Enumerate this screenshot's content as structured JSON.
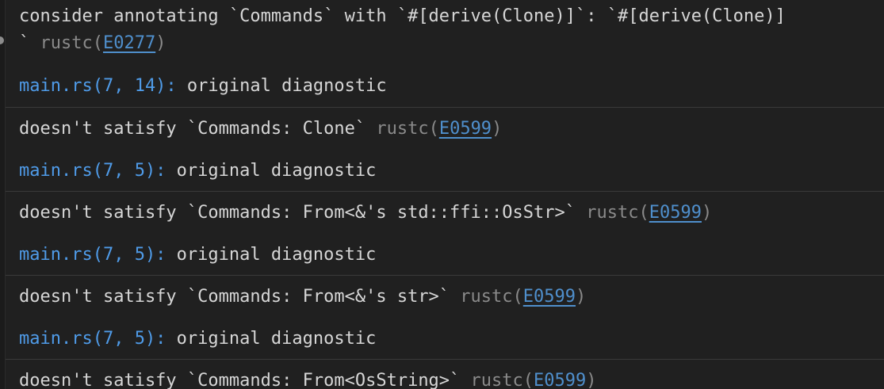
{
  "problems": {
    "entries": [
      {
        "message_lines": [
          "consider annotating `Commands` with `#[derive(Clone)]`: `#[derive(Clone)]",
          "` "
        ],
        "source": "rustc",
        "code": "E0277",
        "related_location": "main.rs(7, 14):",
        "related_text": " original diagnostic"
      },
      {
        "message": "doesn't satisfy `Commands: Clone` ",
        "source": "rustc",
        "code": "E0599",
        "related_location": "main.rs(7, 5):",
        "related_text": " original diagnostic"
      },
      {
        "message": "doesn't satisfy `Commands: From<&'s std::ffi::OsStr>` ",
        "source": "rustc",
        "code": "E0599",
        "related_location": "main.rs(7, 5):",
        "related_text": " original diagnostic"
      },
      {
        "message": "doesn't satisfy `Commands: From<&'s str>` ",
        "source": "rustc",
        "code": "E0599",
        "related_location": "main.rs(7, 5):",
        "related_text": " original diagnostic"
      },
      {
        "message": "doesn't satisfy `Commands: From<OsString>` ",
        "source": "rustc",
        "code": "E0599"
      }
    ],
    "paren_open": "(",
    "paren_close": ")"
  },
  "colors": {
    "background": "#202020",
    "text": "#d6d6d6",
    "source": "#8a8a8a",
    "link": "#4f8fcc",
    "location": "#4f9be8",
    "divider": "#3a3a3a"
  }
}
